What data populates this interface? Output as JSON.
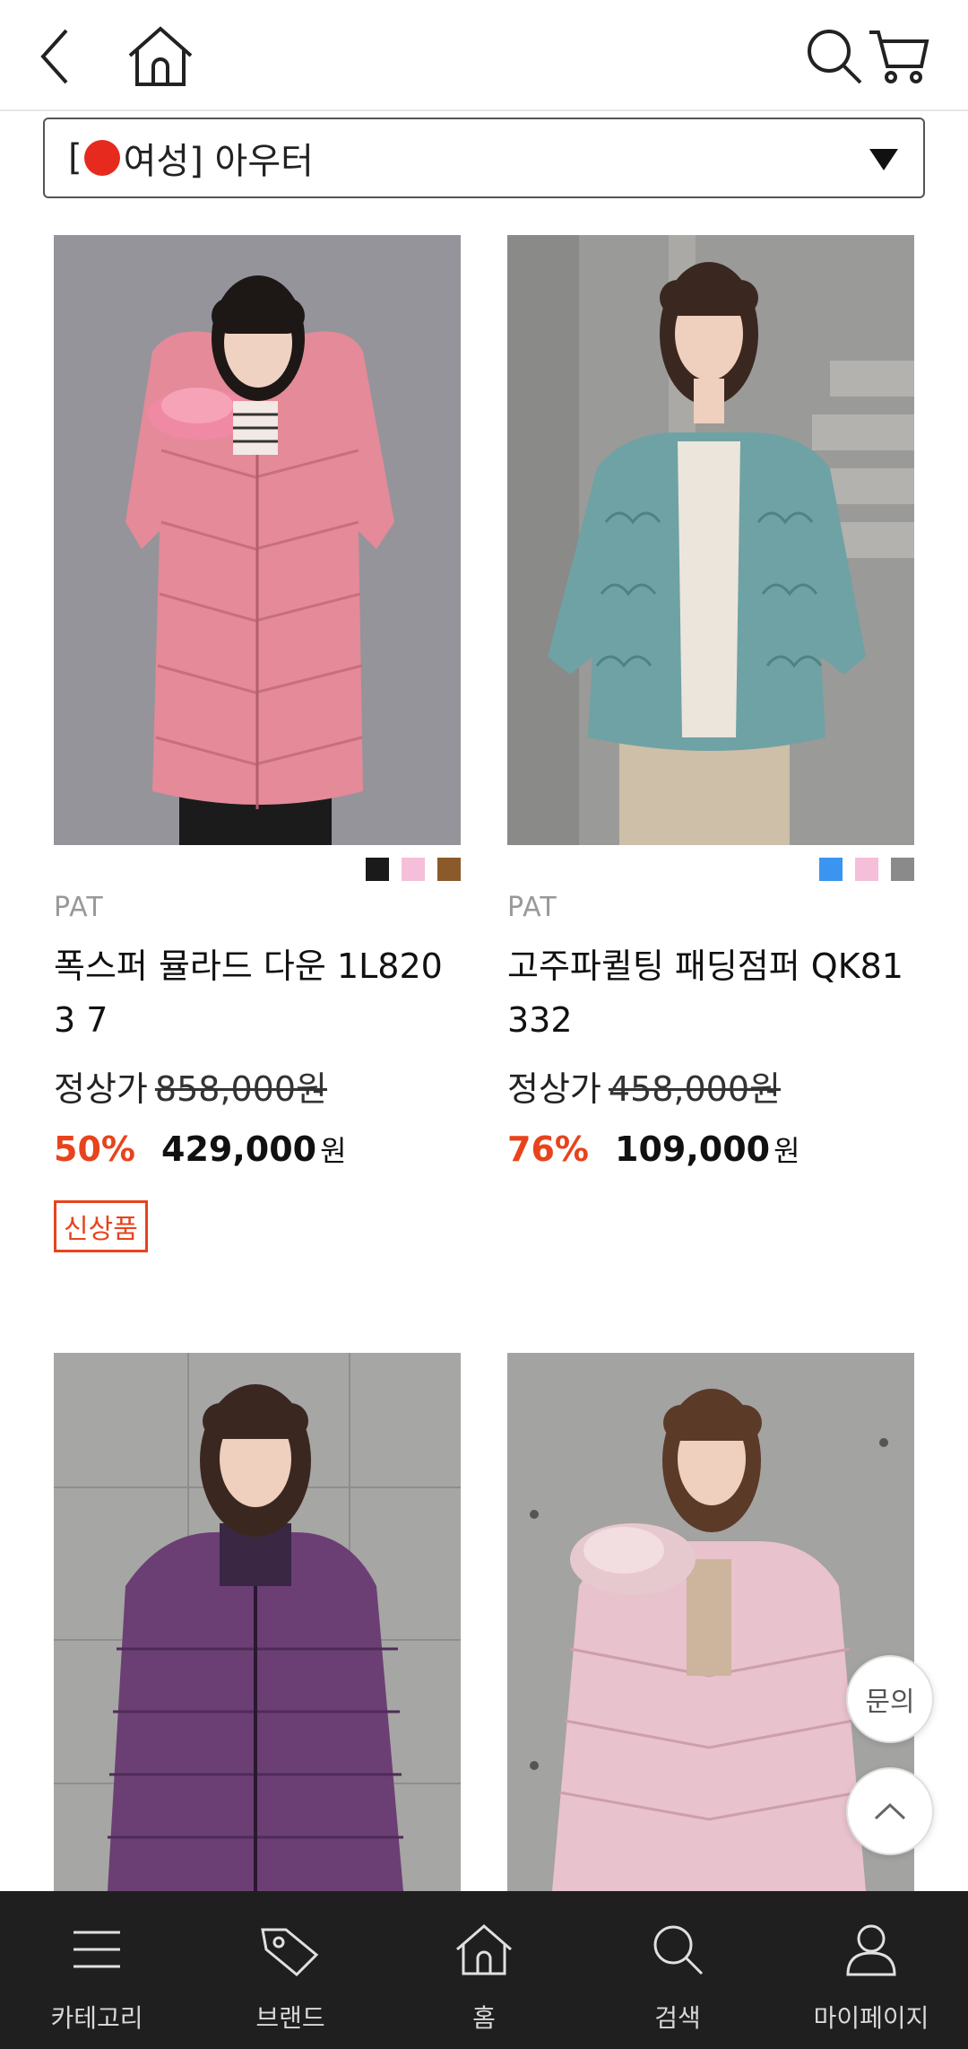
{
  "header": {
    "back_icon": "chevron-left-icon",
    "home_icon": "home-icon",
    "search_icon": "search-icon",
    "cart_icon": "cart-icon"
  },
  "category": {
    "prefix": "[",
    "label": "여성] 아우터",
    "dot_color": "#e62a1e"
  },
  "products": [
    {
      "brand": "PAT",
      "name": "폭스퍼 뮬라드 다운 1L8203 7",
      "orig_label": "정상가",
      "orig_price": "858,000원",
      "discount": "50%",
      "sale_price": "429,000",
      "won": "원",
      "badge": "신상품",
      "swatches": [
        "#1a1a1a",
        "#f6bfd9",
        "#8b5a2b"
      ]
    },
    {
      "brand": "PAT",
      "name": "고주파퀼팅 패딩점퍼 QK81 332",
      "orig_label": "정상가",
      "orig_price": "458,000원",
      "discount": "76%",
      "sale_price": "109,000",
      "won": "원",
      "swatches": [
        "#3b95f0",
        "#f6bfd9",
        "#8a8a8a"
      ]
    }
  ],
  "floating": {
    "inquiry_label": "문의",
    "top_icon": "chevron-up-icon"
  },
  "bottom_nav": [
    {
      "label": "카테고리",
      "icon": "menu-icon"
    },
    {
      "label": "브랜드",
      "icon": "tag-icon"
    },
    {
      "label": "홈",
      "icon": "home-icon"
    },
    {
      "label": "검색",
      "icon": "search-icon"
    },
    {
      "label": "마이페이지",
      "icon": "user-icon"
    }
  ],
  "colors": {
    "accent": "#e8431c",
    "nav_bg": "#1f1f1f"
  }
}
